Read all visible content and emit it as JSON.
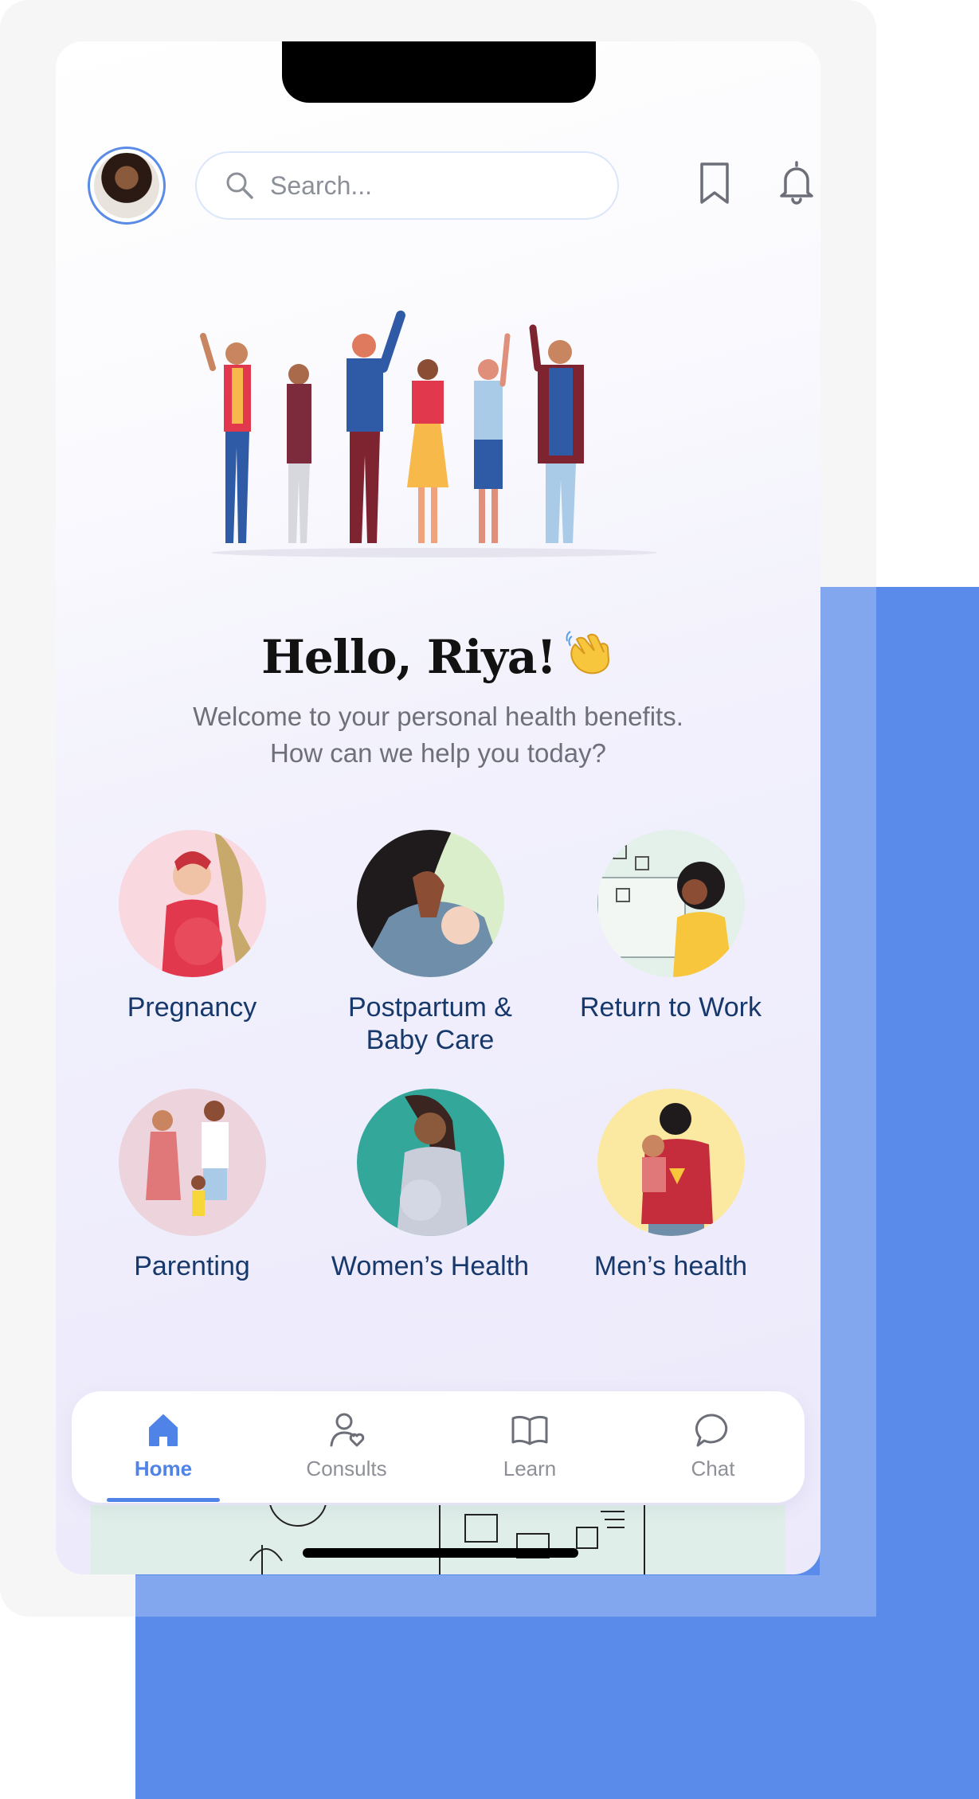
{
  "header": {
    "search_placeholder": "Search..."
  },
  "greeting": {
    "title": "Hello, Riya!",
    "subtitle_line1": "Welcome to your personal health benefits.",
    "subtitle_line2": "How can we help you today?"
  },
  "categories": [
    {
      "label": "Pregnancy"
    },
    {
      "label_line1": "Postpartum &",
      "label_line2": "Baby Care"
    },
    {
      "label": "Return to Work"
    },
    {
      "label": "Parenting"
    },
    {
      "label": "Women’s Health"
    },
    {
      "label": "Men’s health"
    }
  ],
  "tabbar": {
    "tabs": [
      {
        "label": "Home",
        "icon": "home-icon",
        "active": true
      },
      {
        "label": "Consults",
        "icon": "consults-icon"
      },
      {
        "label": "Learn",
        "icon": "book-icon"
      },
      {
        "label": "Chat",
        "icon": "chat-icon"
      }
    ]
  },
  "colors": {
    "accent": "#4f83e8",
    "label_text": "#17386b",
    "backdrop_blue": "#5b8bea"
  }
}
